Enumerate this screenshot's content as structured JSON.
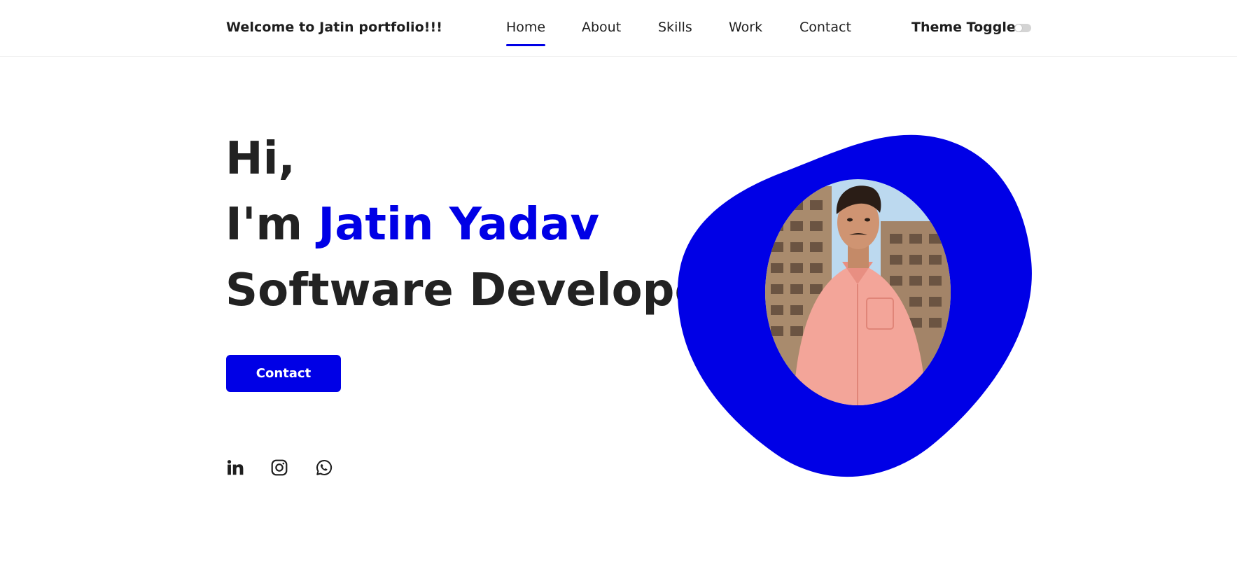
{
  "header": {
    "logo_text": "Welcome to Jatin portfolio!!!",
    "nav": [
      {
        "label": "Home",
        "active": true
      },
      {
        "label": "About",
        "active": false
      },
      {
        "label": "Skills",
        "active": false
      },
      {
        "label": "Work",
        "active": false
      },
      {
        "label": "Contact",
        "active": false
      }
    ],
    "theme_toggle_label": "Theme Toggle:",
    "theme_toggle_on": false
  },
  "hero": {
    "greeting": "Hi,",
    "intro_prefix": "I'm ",
    "name": "Jatin Yadav",
    "role": "Software Developer",
    "contact_button": "Contact"
  },
  "social": [
    {
      "icon": "linkedin-icon"
    },
    {
      "icon": "instagram-icon"
    },
    {
      "icon": "whatsapp-icon"
    }
  ],
  "colors": {
    "accent": "#0000e6",
    "text": "#222222",
    "background": "#ffffff"
  }
}
